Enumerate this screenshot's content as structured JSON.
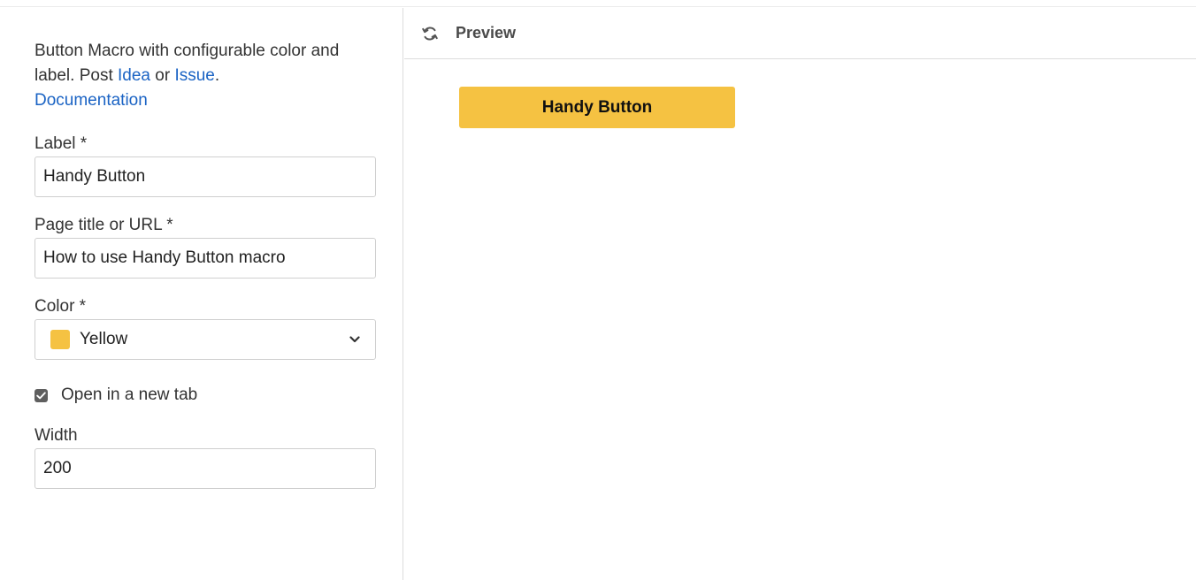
{
  "form": {
    "description": {
      "text_before": "Button Macro with configurable color and label. Post ",
      "idea_link": "Idea",
      "text_or": " or ",
      "issue_link": "Issue",
      "text_period": ".",
      "documentation_link": "Documentation"
    },
    "label": {
      "label": "Label *",
      "value": "Handy Button"
    },
    "page": {
      "label": "Page title or URL *",
      "value": "How to use Handy Button macro"
    },
    "color": {
      "label": "Color *",
      "value": "Yellow",
      "swatch": "#f5c242"
    },
    "new_tab": {
      "label": "Open in a new tab",
      "checked": true
    },
    "width": {
      "label": "Width",
      "value": "200"
    }
  },
  "preview": {
    "title": "Preview",
    "button_label": "Handy Button",
    "button_color": "#f5c242"
  },
  "icons": {
    "refresh": "refresh-icon",
    "dropdown": "chevron-down-icon",
    "checkbox": "checkbox-checked-icon"
  }
}
